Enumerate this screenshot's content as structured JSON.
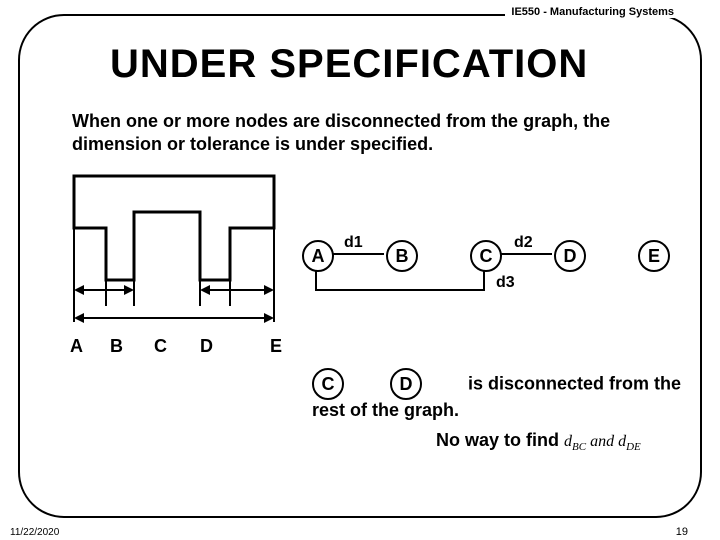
{
  "course_header": "IE550 - Manufacturing Systems",
  "title": "UNDER SPECIFICATION",
  "body_text": "When  one or more nodes are disconnected from the graph, the dimension or tolerance is under specified.",
  "axis": {
    "a": "A",
    "b": "B",
    "c": "C",
    "d": "D",
    "e": "E"
  },
  "graph_nodes": {
    "a": "A",
    "b": "B",
    "c": "C",
    "d": "D",
    "e": "E"
  },
  "graph_edges": {
    "d1": "d1",
    "d2": "d2",
    "d3": "d3"
  },
  "disconnected": {
    "c": "C",
    "d": "D",
    "msg": "is disconnected from the rest of the graph."
  },
  "noway": "No way to find",
  "math_tail": "d<sub>BC</sub> and d<sub>DE</sub>",
  "footer": {
    "date": "11/22/2020",
    "page": "19"
  }
}
